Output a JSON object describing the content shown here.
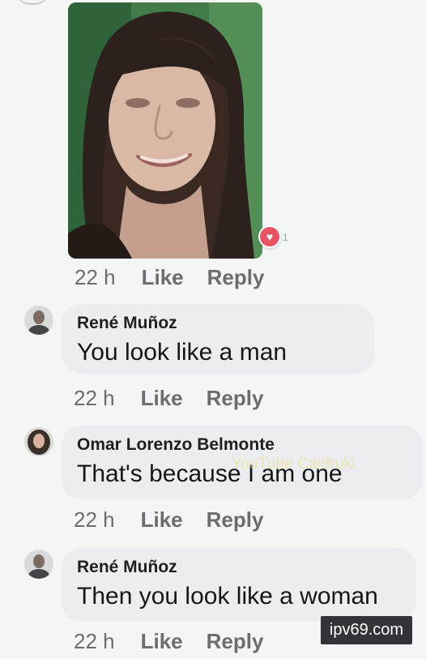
{
  "post": {
    "reaction_count": "1",
    "time": "22 h",
    "like_label": "Like",
    "reply_label": "Reply"
  },
  "comments": [
    {
      "author": "René Muñoz",
      "text": "You look like a man",
      "time": "22 h",
      "like_label": "Like",
      "reply_label": "Reply"
    },
    {
      "author": "Omar Lorenzo Belmonte",
      "text": "That's because I am one",
      "time": "22 h",
      "like_label": "Like",
      "reply_label": "Reply"
    },
    {
      "author": "René Muñoz",
      "text": "Then you look like a woman",
      "time": "22 h",
      "like_label": "Like",
      "reply_label": "Reply"
    }
  ],
  "watermarks": {
    "youtube": "YouTube Caidruki",
    "site": "ipv69.com"
  },
  "icons": {
    "reaction": "heart-icon",
    "avatars": [
      "avatar",
      "avatar",
      "avatar"
    ]
  },
  "colors": {
    "background": "#f4f5f5",
    "bubble": "#ebedf0",
    "reaction": "#e65361",
    "meta_text": "#6b6d70"
  }
}
